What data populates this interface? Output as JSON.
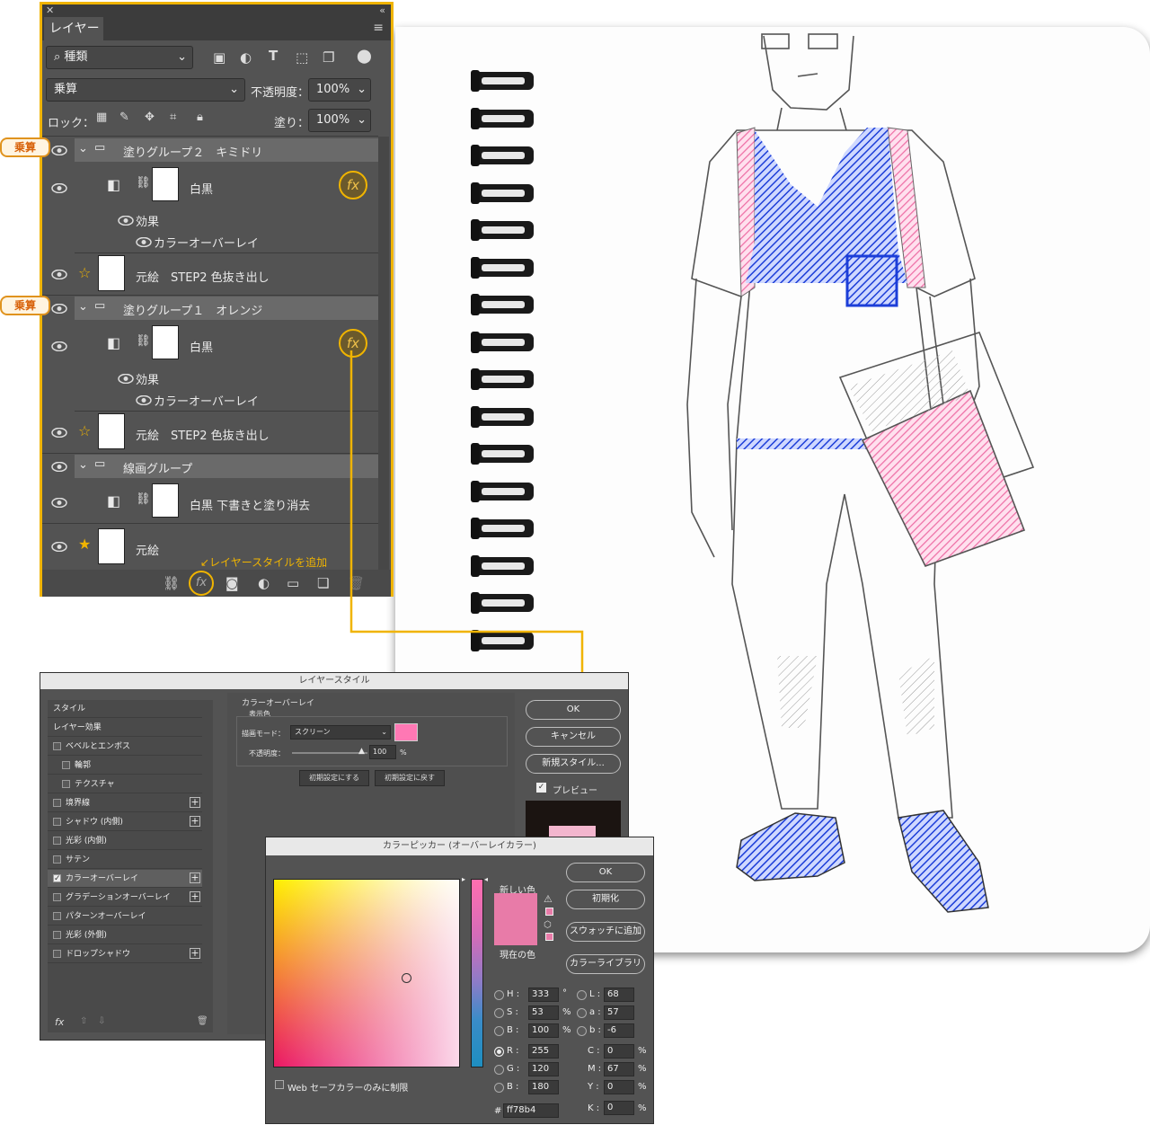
{
  "layers_panel": {
    "tab_title": "レイヤー",
    "filter_kind": "種類",
    "blend_mode": "乗算",
    "opacity_label": "不透明度：",
    "opacity_value": "100%",
    "lock_label": "ロック：",
    "fill_label": "塗り：",
    "fill_value": "100%",
    "multiply_badge": "乗算",
    "layers": {
      "group2": "塗りグループ２　キミドリ",
      "g2_adjust": "白黒",
      "g2_effects": "効果",
      "g2_overlay": "カラーオーバーレイ",
      "g2_source": "元絵　STEP2 色抜き出し",
      "group1": "塗りグループ１　オレンジ",
      "g1_adjust": "白黒",
      "g1_effects": "効果",
      "g1_overlay": "カラーオーバーレイ",
      "g1_source": "元絵　STEP2 色抜き出し",
      "line_group": "線画グループ",
      "line_adjust": "白黒 下書きと塗り消去",
      "original": "元絵"
    },
    "fx_label": "fx",
    "add_style_hint": "↙レイヤースタイルを追加"
  },
  "layer_style_dialog": {
    "title": "レイヤースタイル",
    "style_items": [
      "スタイル",
      "レイヤー効果",
      "ベベルとエンボス",
      "輪郭",
      "テクスチャ",
      "境界線",
      "シャドウ (内側)",
      "光彩 (内側)",
      "サテン",
      "カラーオーバーレイ",
      "グラデーションオーバーレイ",
      "パターンオーバーレイ",
      "光彩 (外側)",
      "ドロップシャドウ"
    ],
    "section_title": "カラーオーバーレイ",
    "subsection": "表示色",
    "blend_mode_label": "描画モード：",
    "blend_mode_value": "スクリーン",
    "opacity_label": "不透明度：",
    "opacity_value": "100",
    "percent": "%",
    "make_default": "初期設定にする",
    "reset_default": "初期設定に戻す",
    "ok": "OK",
    "cancel": "キャンセル",
    "new_style": "新規スタイル...",
    "preview": "プレビュー",
    "fx_label": "fx",
    "overlay_color": "#ff78b4"
  },
  "color_picker": {
    "title": "カラーピッカー (オーバーレイカラー)",
    "new_label": "新しい色",
    "current_label": "現在の色",
    "ok": "OK",
    "reset": "初期化",
    "add_swatch": "スウォッチに追加",
    "color_libraries": "カラーライブラリ",
    "web_only": "Web セーフカラーのみに制限",
    "hsb": [
      {
        "label": "H :",
        "value": "333",
        "unit": "°"
      },
      {
        "label": "S :",
        "value": "53",
        "unit": "%"
      },
      {
        "label": "B :",
        "value": "100",
        "unit": "%"
      }
    ],
    "rgb": [
      {
        "label": "R :",
        "value": "255"
      },
      {
        "label": "G :",
        "value": "120"
      },
      {
        "label": "B :",
        "value": "180"
      }
    ],
    "lab": [
      {
        "label": "L :",
        "value": "68"
      },
      {
        "label": "a :",
        "value": "57"
      },
      {
        "label": "b :",
        "value": "-6"
      }
    ],
    "cmyk": [
      {
        "label": "C :",
        "value": "0",
        "unit": "%"
      },
      {
        "label": "M :",
        "value": "67",
        "unit": "%"
      },
      {
        "label": "Y :",
        "value": "0",
        "unit": "%"
      },
      {
        "label": "K :",
        "value": "0",
        "unit": "%"
      }
    ],
    "hex_label": "#",
    "hex_value": "ff78b4",
    "new_color": "#e87ba8",
    "accent": "#f0b400"
  }
}
